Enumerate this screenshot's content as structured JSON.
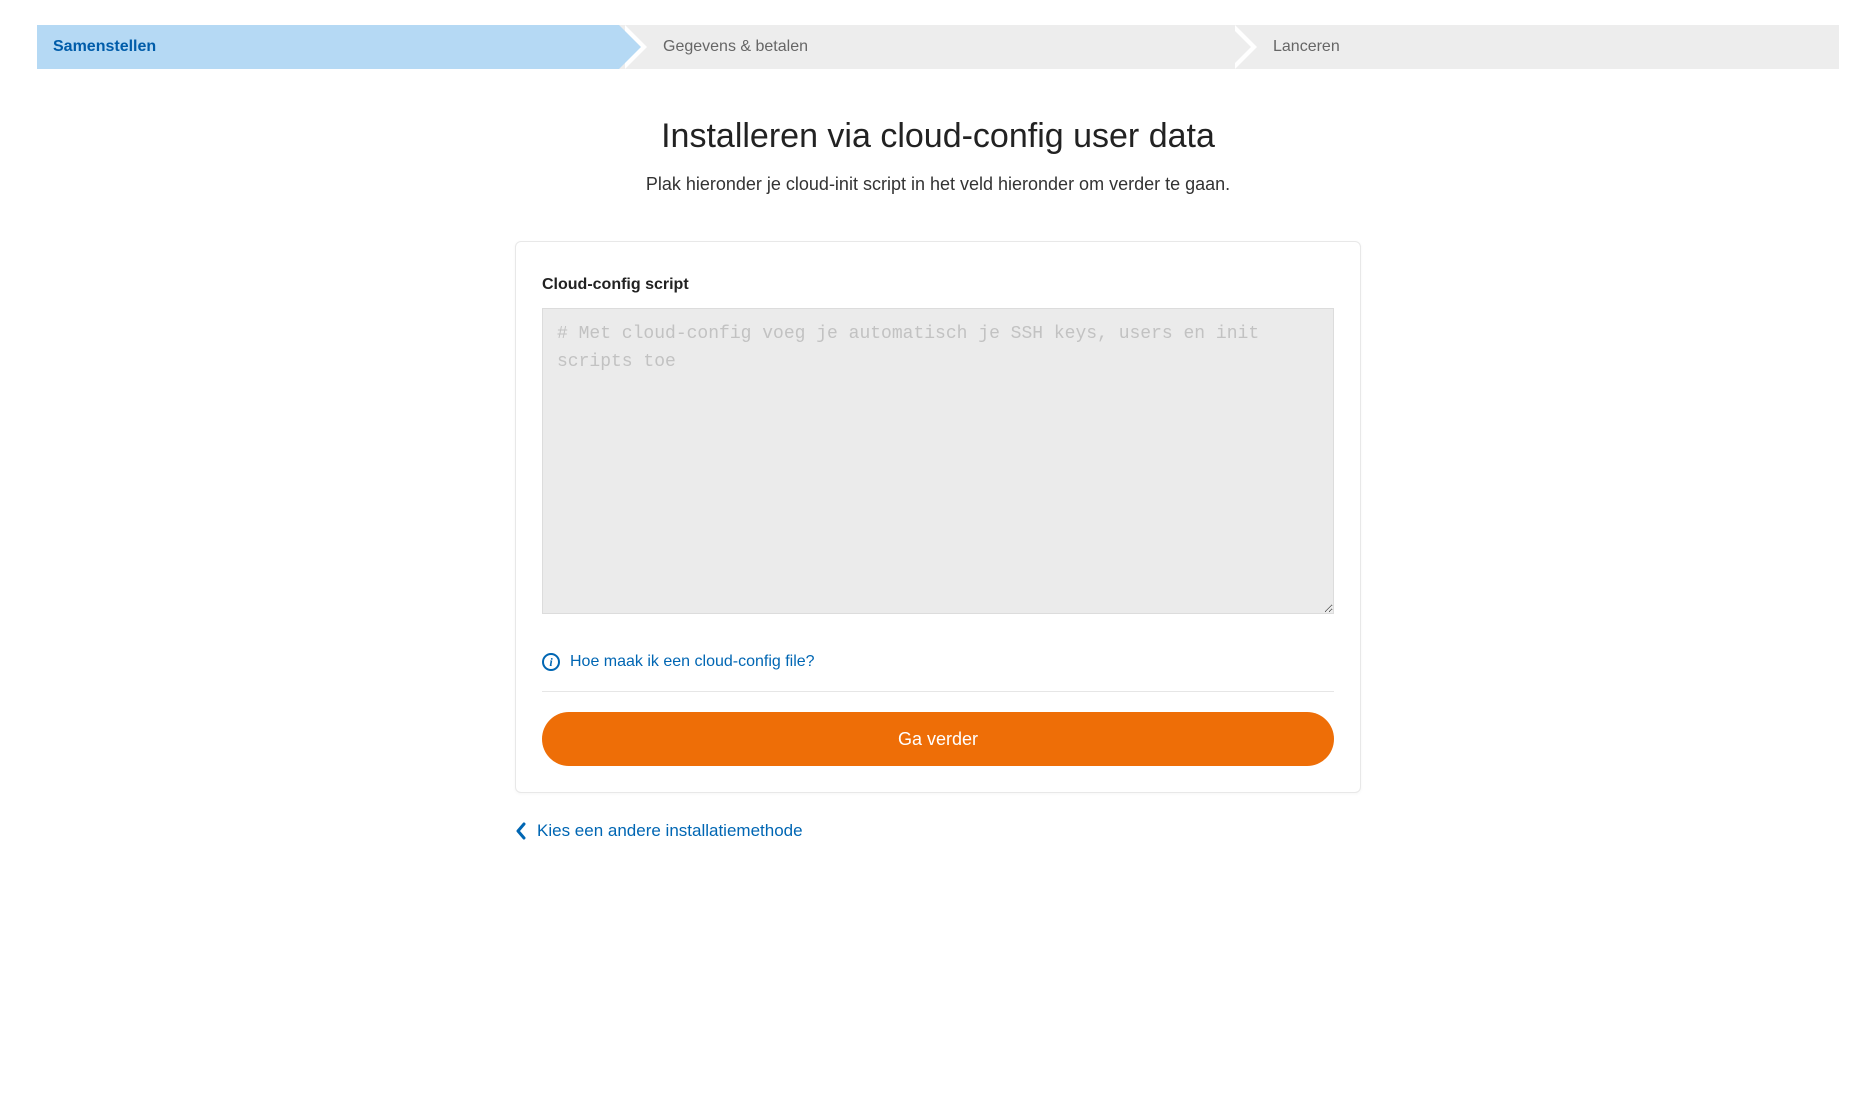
{
  "wizard": {
    "steps": [
      {
        "label": "Samenstellen",
        "active": true
      },
      {
        "label": "Gegevens & betalen",
        "active": false
      },
      {
        "label": "Lanceren",
        "active": false
      }
    ]
  },
  "header": {
    "title": "Installeren via cloud-config user data",
    "subtitle": "Plak hieronder je cloud-init script in het veld hieronder om verder te gaan."
  },
  "form": {
    "script_label": "Cloud-config script",
    "script_value": "",
    "script_placeholder": "# Met cloud-config voeg je automatisch je SSH keys, users en init scripts toe",
    "help_link_text": "Hoe maak ik een cloud-config file?",
    "submit_label": "Ga verder"
  },
  "footer": {
    "back_link_text": "Kies een andere installatiemethode"
  },
  "icons": {
    "info": "info-icon",
    "chevron_left": "chevron-left-icon"
  },
  "colors": {
    "brand_blue": "#0066b3",
    "step_active_bg": "#b5d9f4",
    "step_bg": "#ededed",
    "primary_orange": "#ee6e07"
  }
}
